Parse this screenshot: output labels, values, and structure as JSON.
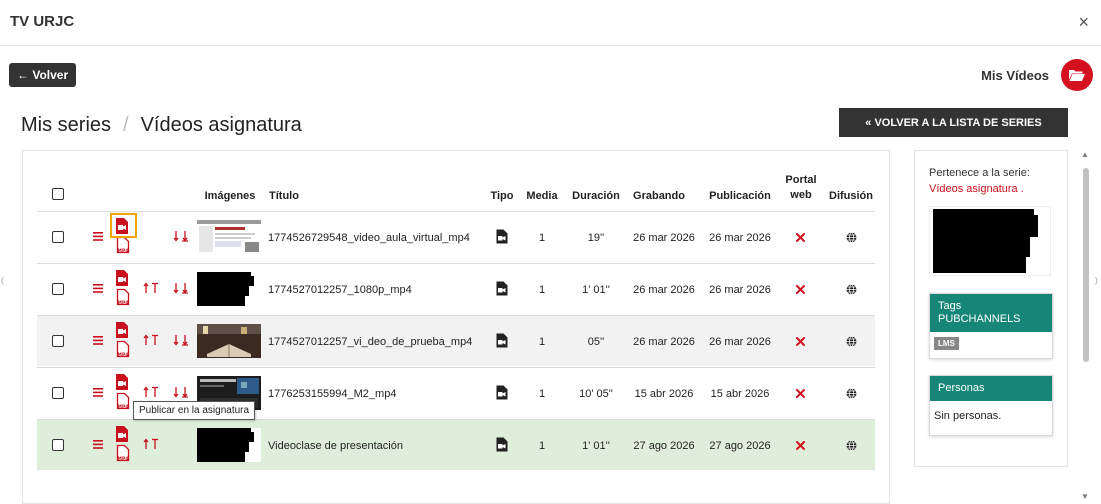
{
  "window": {
    "title": "TV URJC",
    "close_label": "×"
  },
  "toolbar": {
    "back_label": "← Volver",
    "mis_videos_label": "Mis Vídeos"
  },
  "breadcrumb": {
    "parent": "Mis series",
    "separator": "/",
    "current": "Vídeos asignatura"
  },
  "list_button_label": "« VOLVER A LA LISTA DE SERIES",
  "table": {
    "headers": {
      "imagenes": "Imágenes",
      "titulo": "Título",
      "tipo": "Tipo",
      "media": "Media",
      "duracion": "Duración",
      "grabando": "Grabando",
      "publicacion": "Publicación",
      "portal_1": "Portal",
      "portal_2": "web",
      "difusion": "Difusión"
    },
    "rows": [
      {
        "title": "1774526729548_video_aula_virtual_mp4",
        "media": "1",
        "duration": "19''",
        "recorded": "26 mar 2026",
        "published": "26 mar 2026",
        "thumb": "screen",
        "move_up": false,
        "move_down": true,
        "variant": "white"
      },
      {
        "title": "1774527012257_1080p_mp4",
        "media": "1",
        "duration": "1' 01''",
        "recorded": "26 mar 2026",
        "published": "26 mar 2026",
        "thumb": "black",
        "move_up": true,
        "move_down": true,
        "variant": "white"
      },
      {
        "title": "1774527012257_vi_deo_de_prueba_mp4",
        "media": "1",
        "duration": "05''",
        "recorded": "26 mar 2026",
        "published": "26 mar 2026",
        "thumb": "book",
        "move_up": true,
        "move_down": true,
        "variant": "odd"
      },
      {
        "title": "1776253155994_M2_mp4",
        "media": "1",
        "duration": "10' 05''",
        "recorded": "15 abr 2026",
        "published": "15 abr 2026",
        "thumb": "dark",
        "move_up": true,
        "move_down": true,
        "variant": "white"
      },
      {
        "title": "Videoclase de presentación",
        "media": "1",
        "duration": "1' 01''",
        "recorded": "27 ago 2026",
        "published": "27 ago 2026",
        "thumb": "black",
        "move_up": true,
        "move_down": false,
        "variant": "hl"
      }
    ]
  },
  "tooltip": {
    "text": "Publicar en la asignatura"
  },
  "sidebar": {
    "belongs_label": "Pertenece a la serie:",
    "series_link": "Vídeos asignatura",
    "series_link_suffix": ".",
    "tags_title_1": "Tags",
    "tags_title_2": "PUBCHANNELS",
    "tag_badge": "LMS",
    "personas_title": "Personas",
    "personas_body": "Sin personas."
  },
  "colors": {
    "accent": "#d4111e",
    "teal": "#158677",
    "dark_button": "#333333",
    "highlight_row": "#dfeeda",
    "link": "#c8101e"
  }
}
